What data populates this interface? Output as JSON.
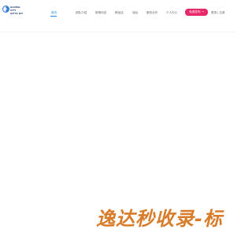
{
  "logo": {
    "lines": [
      "GLOBAL",
      "CITY",
      "GIFTS KIT"
    ],
    "brand_color": "#1f3a6e",
    "accent_color": "#2e7bd6"
  },
  "nav": {
    "items": [
      {
        "label": "首页",
        "active": true
      },
      {
        "label": "团队介绍",
        "active": false
      },
      {
        "label": "新闻动态",
        "active": false
      },
      {
        "label": "精品店",
        "active": false
      },
      {
        "label": "读后",
        "active": false
      },
      {
        "label": "服务合作",
        "active": false
      },
      {
        "label": "个人中心",
        "active": false
      }
    ],
    "active_color": "#1e88e5",
    "text_color": "#666666"
  },
  "cta": {
    "label": "免费发布 →",
    "color": "#e8286a"
  },
  "auth": {
    "login": "登录",
    "separator": "|",
    "register": "注册"
  },
  "banner": {
    "text": "逸达秒收录-标",
    "color": "#d97c2a"
  }
}
